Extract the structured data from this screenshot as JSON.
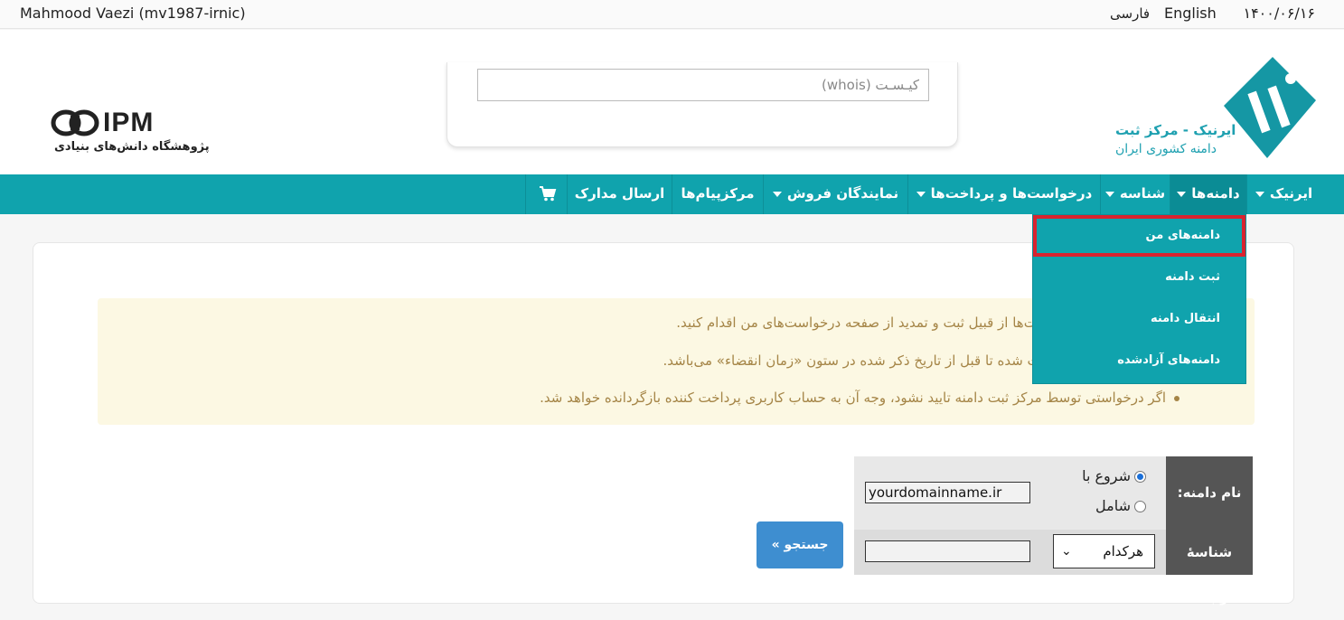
{
  "topbar": {
    "user": "Mahmood Vaezi (mv1987-irnic)",
    "lang_en": "English",
    "lang_fa": "فارسی",
    "date": "۱۴۰۰/۰۶/۱۶"
  },
  "header": {
    "whois_placeholder": "کیـسـت (whois)",
    "ipm_mark": "IPM",
    "ipm_subtitle": "پژوهشگاه دانش‌های بنیادی",
    "irnic_line1": "ایرنیک - مرکز ثبت",
    "irnic_line2": "دامنه کشوری ایران"
  },
  "nav": {
    "items": [
      {
        "label": "ایرنیک",
        "dropdown": true
      },
      {
        "label": "دامنه‌ها",
        "dropdown": true
      },
      {
        "label": "شناسه",
        "dropdown": true
      },
      {
        "label": "درخواست‌ها و پرداخت‌ها",
        "dropdown": true
      },
      {
        "label": "نمایندگان فروش",
        "dropdown": true
      },
      {
        "label": "مرکزپیام‌ها",
        "dropdown": false
      },
      {
        "label": "ارسال مدارک",
        "dropdown": false
      }
    ],
    "cart_icon": "shopping-cart-icon"
  },
  "dropdown": {
    "items": [
      {
        "label": "دامنه‌های من"
      },
      {
        "label": "ثبت دامنه"
      },
      {
        "label": "انتقال دامنه"
      },
      {
        "label": "دامنه‌های آزادشده"
      }
    ]
  },
  "alert": {
    "line1": "ست‌ها از قبیل ثبت و تمدید از صفحه درخواست‌های من اقدام کنید.",
    "line2": "ثبت شده تا قبل از تاریخ ذکر شده در ستون «زمان انقضاء» می‌باشد.",
    "line3": "اگر درخواستی توسط مرکز ثبت دامنه تایید نشود، وجه آن به حساب کاربری پرداخت کننده بازگردانده خواهد شد."
  },
  "form": {
    "domain_label": "نام دامنه:",
    "radio_starts": "شروع با",
    "radio_contains": "شامل",
    "domain_value": "yourdomainname.ir",
    "contact_label": "شناسهٔ رابط:",
    "contact_select": "هرکدام",
    "search_button": "جستجو »"
  },
  "colors": {
    "nav_bg": "#10a3ad",
    "highlight": "#d9232f",
    "button": "#3e8ed0",
    "alert_bg": "#fcf8e3"
  }
}
